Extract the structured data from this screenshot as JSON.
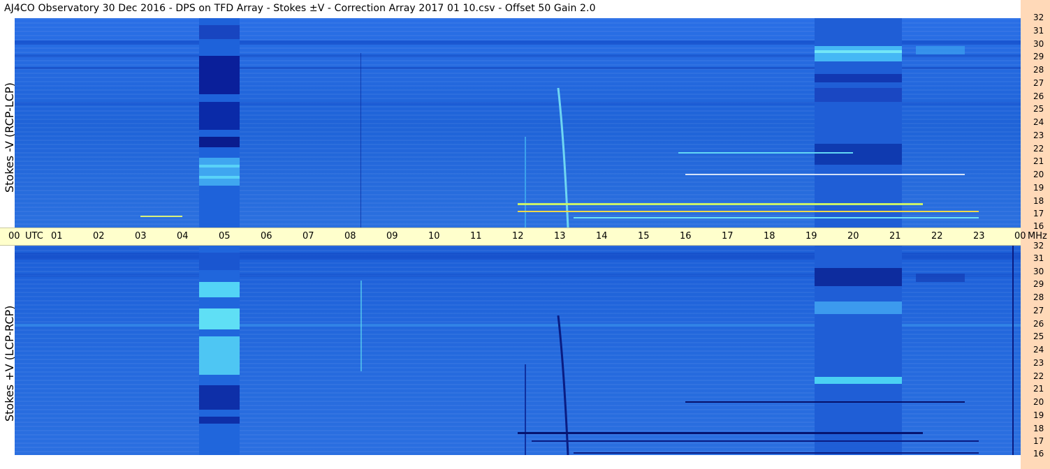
{
  "title": "AJ4CO Observatory  30 Dec 2016  -  DPS on TFD Array  -  Stokes ±V  -  Correction Array 2017 01 10.csv  -  Offset 50  Gain 2.0",
  "panels": {
    "top": {
      "label": "Stokes -V (RCP-LCP)"
    },
    "bottom": {
      "label": "Stokes +V (LCP-RCP)"
    }
  },
  "time_axis": {
    "labels": [
      "00",
      "01",
      "02",
      "03",
      "04",
      "05",
      "06",
      "07",
      "08",
      "09",
      "10",
      "11",
      "12",
      "13",
      "14",
      "15",
      "16",
      "17",
      "18",
      "19",
      "20",
      "21",
      "22",
      "23",
      "00"
    ],
    "utc_label": "UTC",
    "mhz_label": "MHz"
  },
  "freq_axis": {
    "labels": [
      "32",
      "31",
      "30",
      "29",
      "28",
      "27",
      "26",
      "25",
      "24",
      "23",
      "22",
      "21",
      "20",
      "19",
      "18",
      "17",
      "16"
    ]
  },
  "colors": {
    "background_blue": "#1f6fe0",
    "deep_blue": "#0b2fae",
    "bright_cyan": "#41d3f5",
    "axis_band": "#ffffcc",
    "right_strip": "#ffd9b8"
  }
}
